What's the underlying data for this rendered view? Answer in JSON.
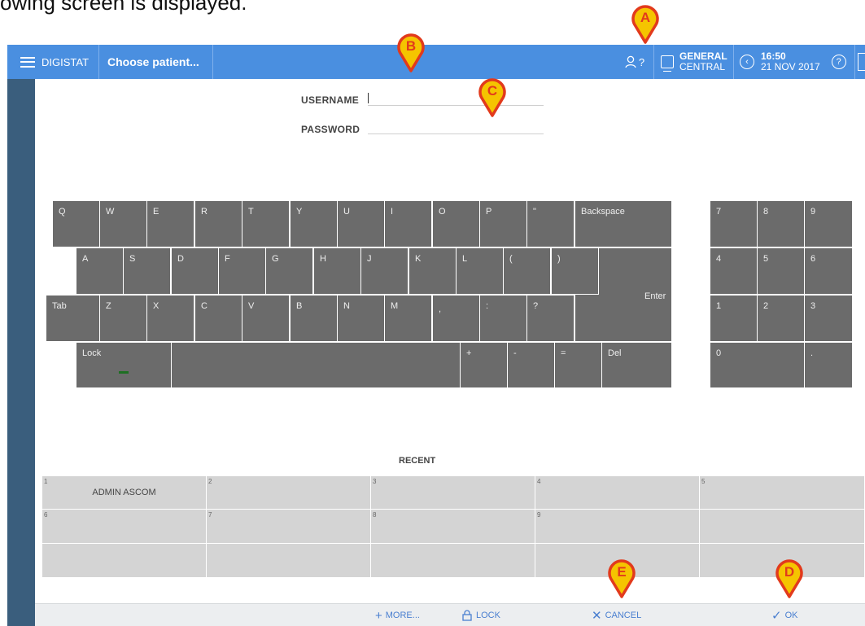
{
  "caption": "owing screen is displayed.",
  "topbar": {
    "menu_label": "DIGISTAT",
    "patient_label": "Choose patient...",
    "user_label": "?",
    "ward_line1": "GENERAL",
    "ward_line2": "CENTRAL",
    "time": "16:50",
    "date": "21 NOV 2017",
    "help_label": "?"
  },
  "login": {
    "username_label": "USERNAME",
    "password_label": "PASSWORD",
    "username_value": "",
    "password_value": ""
  },
  "keyboard": {
    "row1": [
      "Q",
      "W",
      "E",
      "R",
      "T",
      "Y",
      "U",
      "I",
      "O",
      "P",
      "\"",
      "Backspace"
    ],
    "row2": [
      "A",
      "S",
      "D",
      "F",
      "G",
      "H",
      "J",
      "K",
      "L",
      "(",
      ")"
    ],
    "row3": [
      "Tab",
      "Z",
      "X",
      "C",
      "V",
      "B",
      "N",
      "M",
      ",",
      ":",
      "?"
    ],
    "row4": [
      "Lock",
      "",
      "+",
      "-",
      "=",
      "Del"
    ],
    "enter": "Enter",
    "numpad": [
      "7",
      "8",
      "9",
      "4",
      "5",
      "6",
      "1",
      "2",
      "3",
      "0",
      "."
    ]
  },
  "recent": {
    "title": "RECENT",
    "row1": [
      {
        "num": "1",
        "name": "ADMIN ASCOM"
      },
      {
        "num": "2",
        "name": ""
      },
      {
        "num": "3",
        "name": ""
      },
      {
        "num": "4",
        "name": ""
      },
      {
        "num": "5",
        "name": ""
      }
    ],
    "row2": [
      {
        "num": "6",
        "name": ""
      },
      {
        "num": "7",
        "name": ""
      },
      {
        "num": "8",
        "name": ""
      },
      {
        "num": "9",
        "name": ""
      },
      {
        "num": "",
        "name": ""
      }
    ]
  },
  "bottombar": {
    "more_label": "MORE...",
    "lock_label": "LOCK",
    "cancel_label": "CANCEL",
    "ok_label": "OK"
  },
  "markers": [
    "A",
    "B",
    "C",
    "D",
    "E"
  ],
  "colors": {
    "topbar": "#4a8fe0",
    "rail": "#3a5e7d",
    "key": "#6b6b6b",
    "recent_cell": "#d4d4d4",
    "marker_fill": "#f5c400",
    "marker_stroke": "#e23a1c",
    "action_text": "#4a7fd0"
  }
}
